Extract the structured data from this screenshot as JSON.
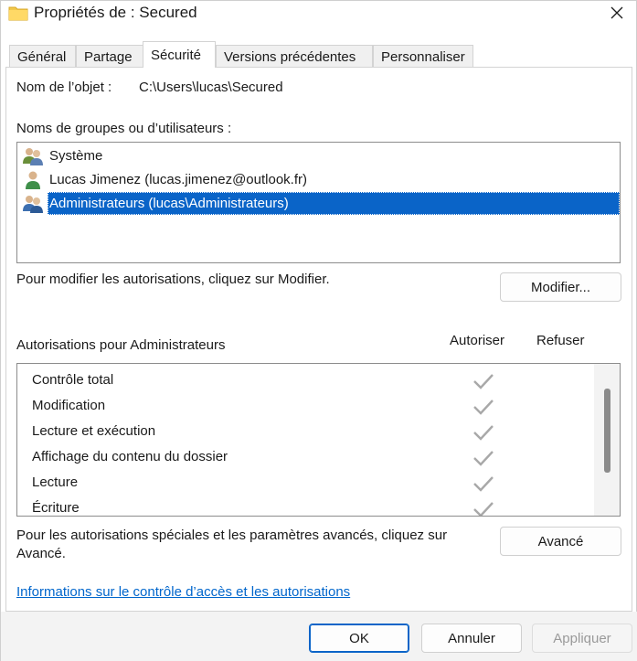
{
  "window": {
    "title": "Propriétés de : Secured",
    "title_icon": "folder-icon",
    "close_icon": "close-icon"
  },
  "tabs": [
    {
      "label": "Général",
      "active": false
    },
    {
      "label": "Partage",
      "active": false
    },
    {
      "label": "Sécurité",
      "active": true
    },
    {
      "label": "Versions précédentes",
      "active": false
    },
    {
      "label": "Personnaliser",
      "active": false
    }
  ],
  "object": {
    "label": "Nom de l’objet :",
    "value": "C:\\Users\\lucas\\Secured"
  },
  "groups": {
    "label": "Noms de groupes ou d’utilisateurs :",
    "items": [
      {
        "name": "Système",
        "icon": "group-users-icon",
        "selected": false
      },
      {
        "name": "Lucas Jimenez (lucas.jimenez@outlook.fr)",
        "icon": "user-icon",
        "selected": false
      },
      {
        "name": "Administrateurs (lucas\\Administrateurs)",
        "icon": "group-users-icon",
        "selected": true
      }
    ]
  },
  "modify": {
    "hint": "Pour modifier les autorisations, cliquez sur Modifier.",
    "button": "Modifier..."
  },
  "permissions": {
    "title": "Autorisations pour Administrateurs",
    "allow_header": "Autoriser",
    "deny_header": "Refuser",
    "items": [
      {
        "name": "Contrôle total",
        "allow": true,
        "deny": false
      },
      {
        "name": "Modification",
        "allow": true,
        "deny": false
      },
      {
        "name": "Lecture et exécution",
        "allow": true,
        "deny": false
      },
      {
        "name": "Affichage du contenu du dossier",
        "allow": true,
        "deny": false
      },
      {
        "name": "Lecture",
        "allow": true,
        "deny": false
      },
      {
        "name": "Écriture",
        "allow": true,
        "deny": false
      }
    ]
  },
  "advanced": {
    "hint_line1": "Pour les autorisations spéciales et les paramètres avancés, cliquez sur",
    "hint_line2": "Avancé.",
    "button": "Avancé"
  },
  "info_link": "Informations sur le contrôle d’accès et les autorisations",
  "footer": {
    "ok": "OK",
    "cancel": "Annuler",
    "apply": "Appliquer",
    "apply_enabled": false
  },
  "colors": {
    "selection": "#0a64c8",
    "link": "#0066cc",
    "check_inherited": "#a8a8a8"
  }
}
